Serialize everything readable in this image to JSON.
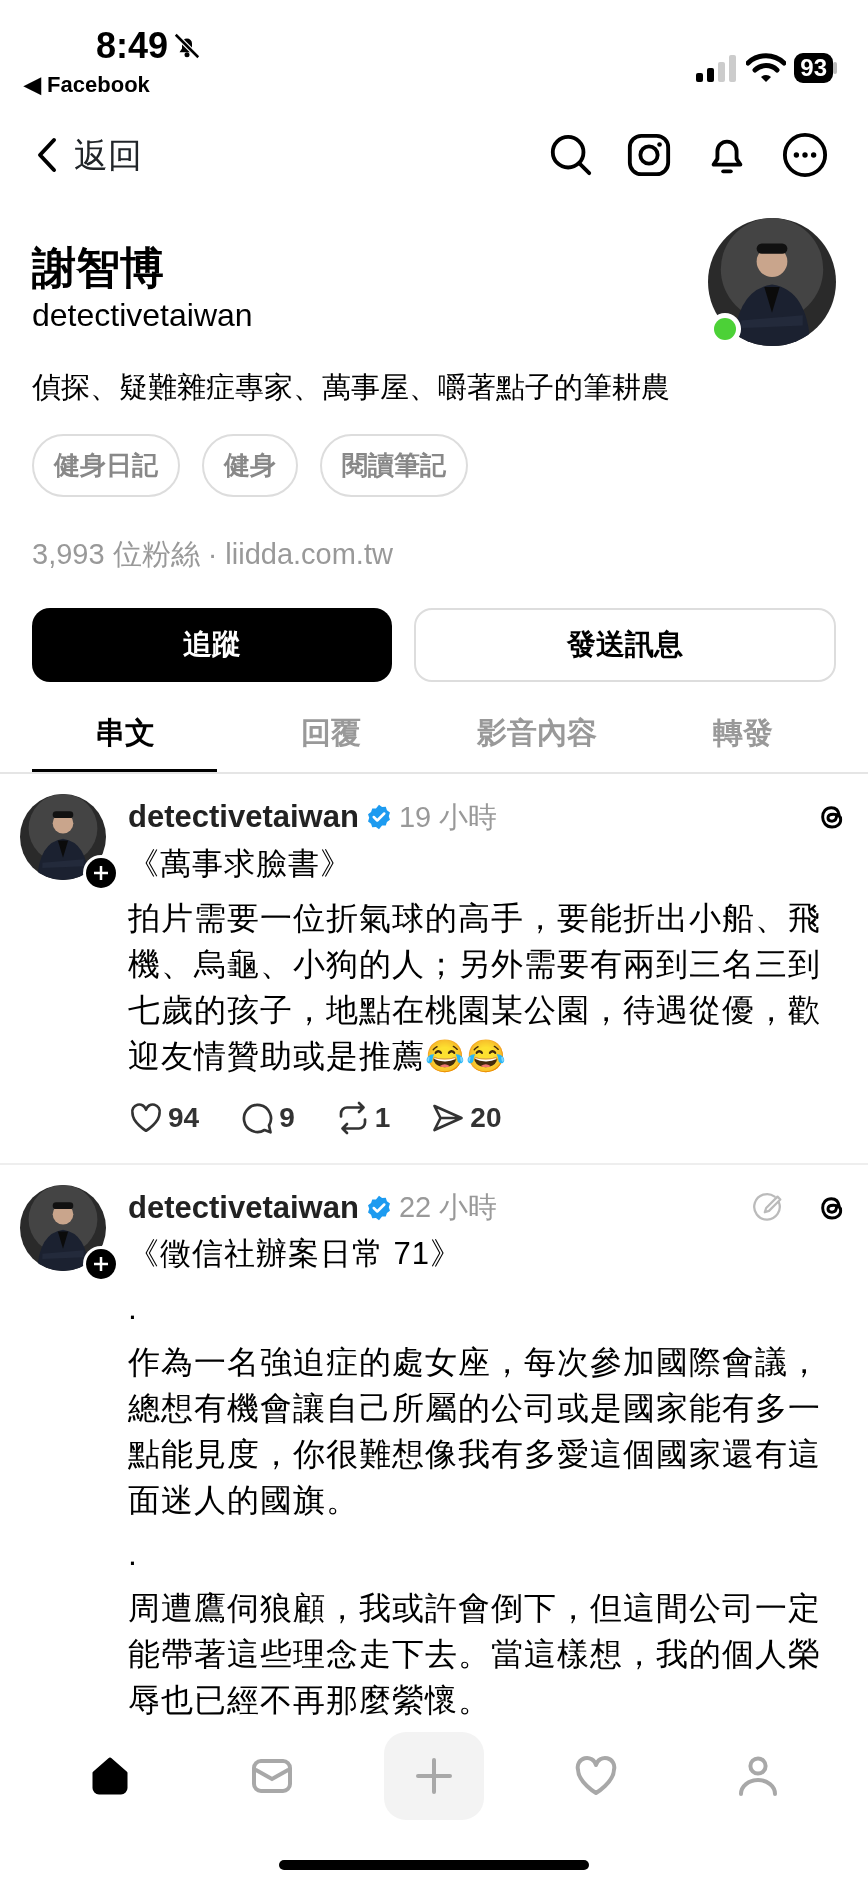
{
  "status_bar": {
    "time": "8:49",
    "silent": true,
    "back_app": "Facebook",
    "back_arrow": "◀",
    "battery": "93"
  },
  "header": {
    "back_label": "返回"
  },
  "profile": {
    "name": "謝智博",
    "handle": "detectivetaiwan",
    "online": true,
    "bio": "偵探、疑難雜症專家、萬事屋、嚼著點子的筆耕農",
    "tags": [
      "健身日記",
      "健身",
      "閱讀筆記"
    ],
    "followers": "3,993 位粉絲",
    "separator": "·",
    "link": "liidda.com.tw"
  },
  "buttons": {
    "follow": "追蹤",
    "message": "發送訊息"
  },
  "tabs": [
    {
      "label": "串文",
      "selected": true
    },
    {
      "label": "回覆",
      "selected": false
    },
    {
      "label": "影音內容",
      "selected": false
    },
    {
      "label": "轉發",
      "selected": false
    }
  ],
  "posts": [
    {
      "author": "detectivetaiwan",
      "verified": true,
      "time": "19 小時",
      "edit_mark": false,
      "title": "《萬事求臉書》",
      "paragraphs": [
        "拍片需要一位折氣球的高手，要能折出小船、飛機、烏龜、小狗的人；另外需要有兩到三名三到七歲的孩子，地點在桃園某公園，待遇從優，歡迎友情贊助或是推薦😂😂"
      ],
      "likes": "94",
      "replies": "9",
      "reposts": "1",
      "shares": "20"
    },
    {
      "author": "detectivetaiwan",
      "verified": true,
      "time": "22 小時",
      "edit_mark": true,
      "title": "《徵信社辦案日常 71》",
      "paragraphs": [
        ".",
        "作為一名強迫症的處女座，每次參加國際會議，總想有機會讓自己所屬的公司或是國家能有多一點能見度，你很難想像我有多愛這個國家還有這面迷人的國旗。",
        ".",
        "周遭鷹伺狼顧，我或許會倒下，但這間公司一定能帶著這些理念走下去。當這樣想，我的個人榮辱也已經不再那麼縈懷。"
      ]
    }
  ],
  "bottom_nav": [
    {
      "kind": "home",
      "selected": true
    },
    {
      "kind": "mail",
      "selected": false
    },
    {
      "kind": "create",
      "selected": false
    },
    {
      "kind": "activity",
      "selected": false
    },
    {
      "kind": "profile",
      "selected": false
    }
  ]
}
